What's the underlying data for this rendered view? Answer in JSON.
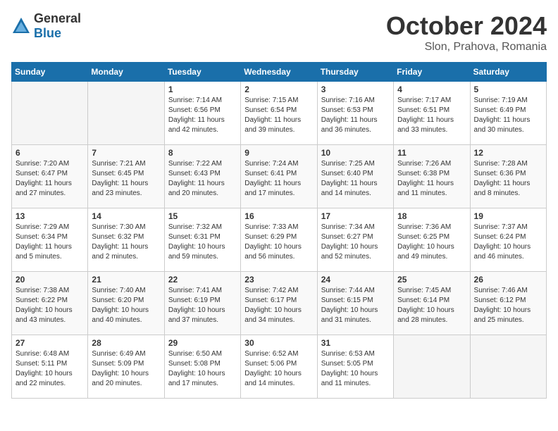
{
  "header": {
    "logo_general": "General",
    "logo_blue": "Blue",
    "month": "October 2024",
    "location": "Slon, Prahova, Romania"
  },
  "days_of_week": [
    "Sunday",
    "Monday",
    "Tuesday",
    "Wednesday",
    "Thursday",
    "Friday",
    "Saturday"
  ],
  "weeks": [
    [
      {
        "num": "",
        "sunrise": "",
        "sunset": "",
        "daylight": ""
      },
      {
        "num": "",
        "sunrise": "",
        "sunset": "",
        "daylight": ""
      },
      {
        "num": "1",
        "sunrise": "Sunrise: 7:14 AM",
        "sunset": "Sunset: 6:56 PM",
        "daylight": "Daylight: 11 hours and 42 minutes."
      },
      {
        "num": "2",
        "sunrise": "Sunrise: 7:15 AM",
        "sunset": "Sunset: 6:54 PM",
        "daylight": "Daylight: 11 hours and 39 minutes."
      },
      {
        "num": "3",
        "sunrise": "Sunrise: 7:16 AM",
        "sunset": "Sunset: 6:53 PM",
        "daylight": "Daylight: 11 hours and 36 minutes."
      },
      {
        "num": "4",
        "sunrise": "Sunrise: 7:17 AM",
        "sunset": "Sunset: 6:51 PM",
        "daylight": "Daylight: 11 hours and 33 minutes."
      },
      {
        "num": "5",
        "sunrise": "Sunrise: 7:19 AM",
        "sunset": "Sunset: 6:49 PM",
        "daylight": "Daylight: 11 hours and 30 minutes."
      }
    ],
    [
      {
        "num": "6",
        "sunrise": "Sunrise: 7:20 AM",
        "sunset": "Sunset: 6:47 PM",
        "daylight": "Daylight: 11 hours and 27 minutes."
      },
      {
        "num": "7",
        "sunrise": "Sunrise: 7:21 AM",
        "sunset": "Sunset: 6:45 PM",
        "daylight": "Daylight: 11 hours and 23 minutes."
      },
      {
        "num": "8",
        "sunrise": "Sunrise: 7:22 AM",
        "sunset": "Sunset: 6:43 PM",
        "daylight": "Daylight: 11 hours and 20 minutes."
      },
      {
        "num": "9",
        "sunrise": "Sunrise: 7:24 AM",
        "sunset": "Sunset: 6:41 PM",
        "daylight": "Daylight: 11 hours and 17 minutes."
      },
      {
        "num": "10",
        "sunrise": "Sunrise: 7:25 AM",
        "sunset": "Sunset: 6:40 PM",
        "daylight": "Daylight: 11 hours and 14 minutes."
      },
      {
        "num": "11",
        "sunrise": "Sunrise: 7:26 AM",
        "sunset": "Sunset: 6:38 PM",
        "daylight": "Daylight: 11 hours and 11 minutes."
      },
      {
        "num": "12",
        "sunrise": "Sunrise: 7:28 AM",
        "sunset": "Sunset: 6:36 PM",
        "daylight": "Daylight: 11 hours and 8 minutes."
      }
    ],
    [
      {
        "num": "13",
        "sunrise": "Sunrise: 7:29 AM",
        "sunset": "Sunset: 6:34 PM",
        "daylight": "Daylight: 11 hours and 5 minutes."
      },
      {
        "num": "14",
        "sunrise": "Sunrise: 7:30 AM",
        "sunset": "Sunset: 6:32 PM",
        "daylight": "Daylight: 11 hours and 2 minutes."
      },
      {
        "num": "15",
        "sunrise": "Sunrise: 7:32 AM",
        "sunset": "Sunset: 6:31 PM",
        "daylight": "Daylight: 10 hours and 59 minutes."
      },
      {
        "num": "16",
        "sunrise": "Sunrise: 7:33 AM",
        "sunset": "Sunset: 6:29 PM",
        "daylight": "Daylight: 10 hours and 56 minutes."
      },
      {
        "num": "17",
        "sunrise": "Sunrise: 7:34 AM",
        "sunset": "Sunset: 6:27 PM",
        "daylight": "Daylight: 10 hours and 52 minutes."
      },
      {
        "num": "18",
        "sunrise": "Sunrise: 7:36 AM",
        "sunset": "Sunset: 6:25 PM",
        "daylight": "Daylight: 10 hours and 49 minutes."
      },
      {
        "num": "19",
        "sunrise": "Sunrise: 7:37 AM",
        "sunset": "Sunset: 6:24 PM",
        "daylight": "Daylight: 10 hours and 46 minutes."
      }
    ],
    [
      {
        "num": "20",
        "sunrise": "Sunrise: 7:38 AM",
        "sunset": "Sunset: 6:22 PM",
        "daylight": "Daylight: 10 hours and 43 minutes."
      },
      {
        "num": "21",
        "sunrise": "Sunrise: 7:40 AM",
        "sunset": "Sunset: 6:20 PM",
        "daylight": "Daylight: 10 hours and 40 minutes."
      },
      {
        "num": "22",
        "sunrise": "Sunrise: 7:41 AM",
        "sunset": "Sunset: 6:19 PM",
        "daylight": "Daylight: 10 hours and 37 minutes."
      },
      {
        "num": "23",
        "sunrise": "Sunrise: 7:42 AM",
        "sunset": "Sunset: 6:17 PM",
        "daylight": "Daylight: 10 hours and 34 minutes."
      },
      {
        "num": "24",
        "sunrise": "Sunrise: 7:44 AM",
        "sunset": "Sunset: 6:15 PM",
        "daylight": "Daylight: 10 hours and 31 minutes."
      },
      {
        "num": "25",
        "sunrise": "Sunrise: 7:45 AM",
        "sunset": "Sunset: 6:14 PM",
        "daylight": "Daylight: 10 hours and 28 minutes."
      },
      {
        "num": "26",
        "sunrise": "Sunrise: 7:46 AM",
        "sunset": "Sunset: 6:12 PM",
        "daylight": "Daylight: 10 hours and 25 minutes."
      }
    ],
    [
      {
        "num": "27",
        "sunrise": "Sunrise: 6:48 AM",
        "sunset": "Sunset: 5:11 PM",
        "daylight": "Daylight: 10 hours and 22 minutes."
      },
      {
        "num": "28",
        "sunrise": "Sunrise: 6:49 AM",
        "sunset": "Sunset: 5:09 PM",
        "daylight": "Daylight: 10 hours and 20 minutes."
      },
      {
        "num": "29",
        "sunrise": "Sunrise: 6:50 AM",
        "sunset": "Sunset: 5:08 PM",
        "daylight": "Daylight: 10 hours and 17 minutes."
      },
      {
        "num": "30",
        "sunrise": "Sunrise: 6:52 AM",
        "sunset": "Sunset: 5:06 PM",
        "daylight": "Daylight: 10 hours and 14 minutes."
      },
      {
        "num": "31",
        "sunrise": "Sunrise: 6:53 AM",
        "sunset": "Sunset: 5:05 PM",
        "daylight": "Daylight: 10 hours and 11 minutes."
      },
      {
        "num": "",
        "sunrise": "",
        "sunset": "",
        "daylight": ""
      },
      {
        "num": "",
        "sunrise": "",
        "sunset": "",
        "daylight": ""
      }
    ]
  ]
}
